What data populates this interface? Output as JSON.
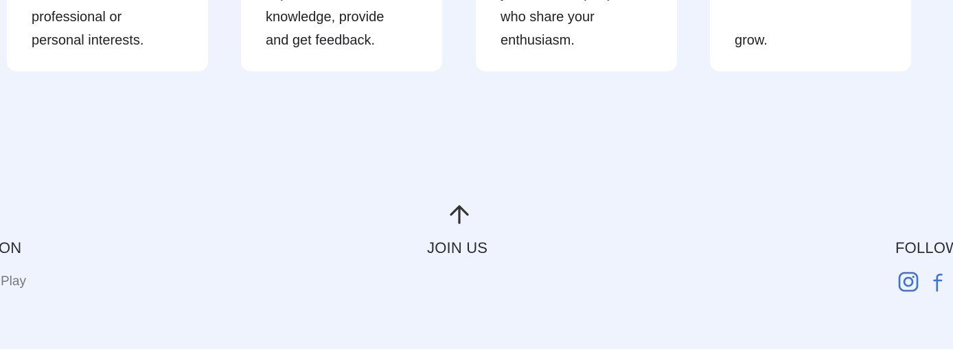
{
  "cards": [
    {
      "text": "with similar\nprofessional or\npersonal interests."
    },
    {
      "text": "experiences and\nknowledge, provide\nand get feedback."
    },
    {
      "text": "you love with people\nwho share your\nenthusiasm."
    },
    {
      "text": "grow."
    }
  ],
  "footer": {
    "left_heading": "ON",
    "left_link": "Play",
    "center_heading": "JOIN US",
    "right_heading": "FOLLOW"
  },
  "icons": {
    "scroll_top": "arrow-up-icon",
    "instagram": "instagram-icon",
    "facebook": "facebook-icon"
  },
  "colors": {
    "background": "#eff3fd",
    "card": "#ffffff",
    "social_icon": "#3f6fd8",
    "arrow": "#333333"
  }
}
